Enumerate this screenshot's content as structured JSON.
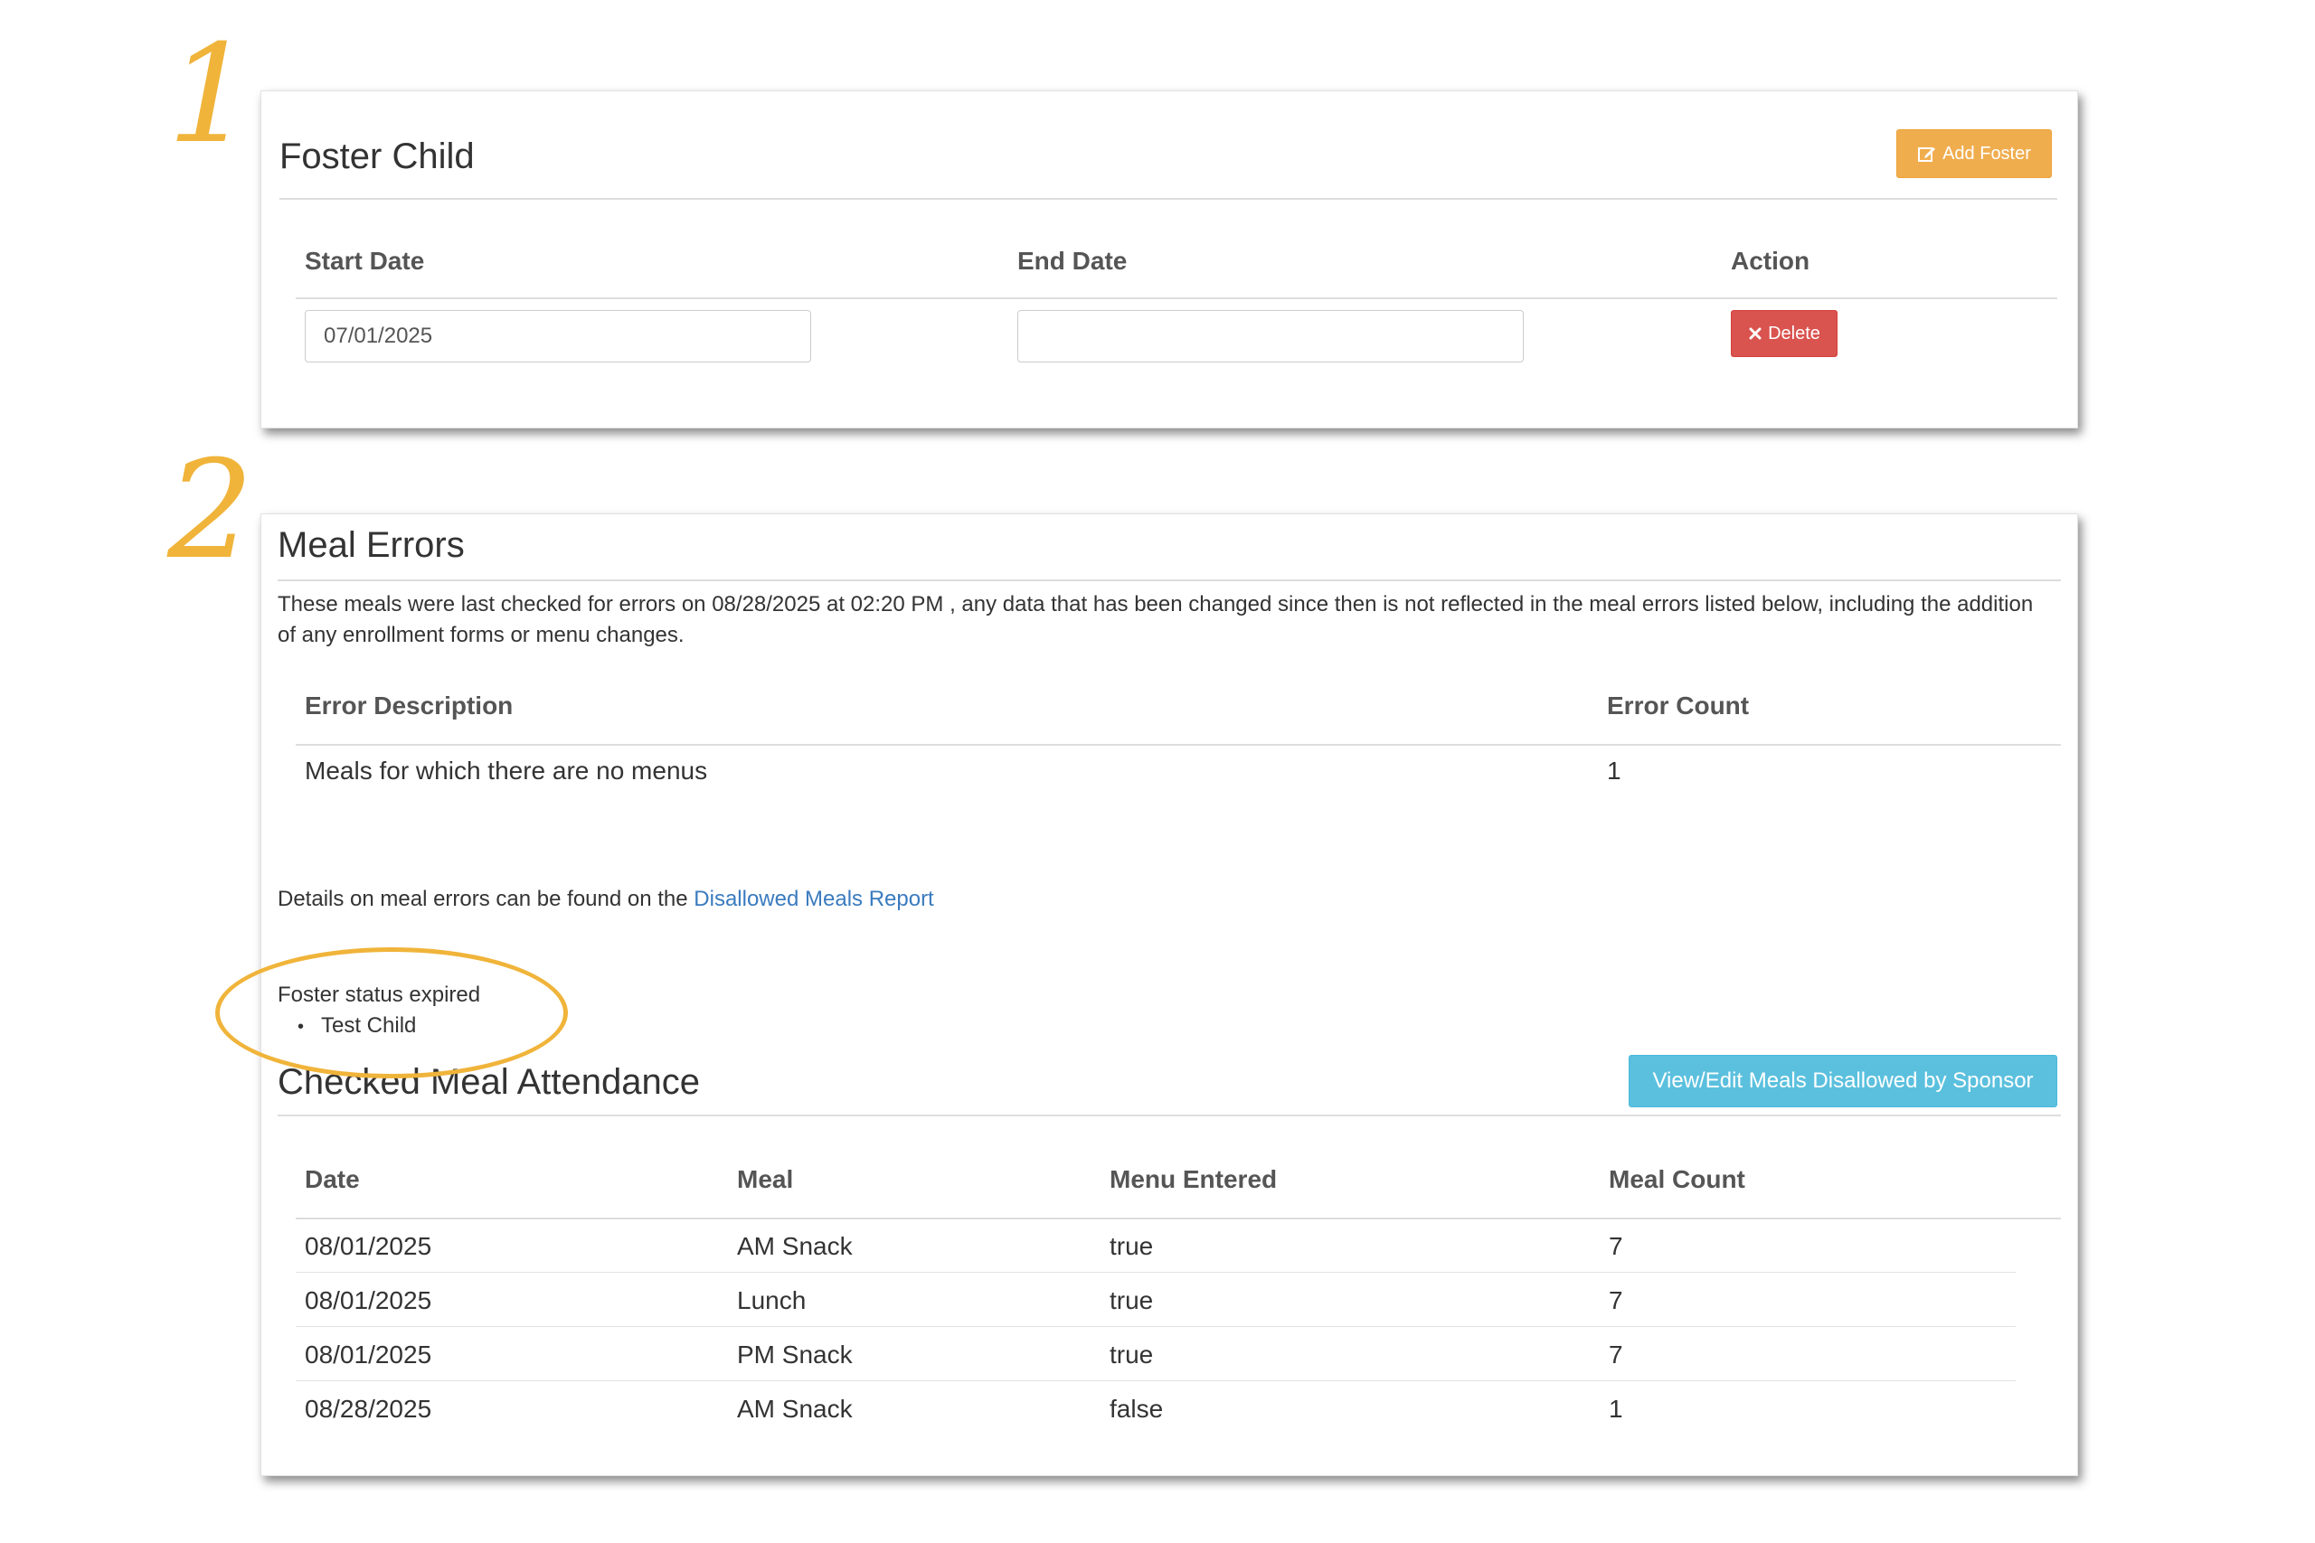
{
  "steps": {
    "one": "1",
    "two": "2"
  },
  "foster_child": {
    "title": "Foster Child",
    "add_button_label": "Add Foster",
    "columns": {
      "start_date": "Start Date",
      "end_date": "End Date",
      "action": "Action"
    },
    "row": {
      "start_date": "07/01/2025",
      "end_date": "",
      "delete_label": "Delete"
    }
  },
  "meal_errors": {
    "title": "Meal Errors",
    "notice_line1": "These meals were last checked for errors on 08/28/2025 at 02:20 PM , any data that has been changed since then is not reflected in the meal errors listed below, including the addition",
    "notice_line2": "of any enrollment forms or menu changes.",
    "columns": {
      "description": "Error Description",
      "count": "Error Count"
    },
    "rows": [
      {
        "description": "Meals for which there are no menus",
        "count": "1"
      }
    ],
    "details_prefix": "Details on meal errors can be found on the",
    "details_link": "Disallowed Meals Report",
    "foster_status_label": "Foster status expired",
    "foster_status_items": [
      "Test Child"
    ]
  },
  "checked_attendance": {
    "title": "Checked Meal Attendance",
    "view_edit_button": "View/Edit Meals Disallowed by Sponsor",
    "columns": {
      "date": "Date",
      "meal": "Meal",
      "menu_entered": "Menu Entered",
      "meal_count": "Meal Count"
    },
    "rows": [
      {
        "date": "08/01/2025",
        "meal": "AM Snack",
        "menu_entered": "true",
        "meal_count": "7"
      },
      {
        "date": "08/01/2025",
        "meal": "Lunch",
        "menu_entered": "true",
        "meal_count": "7"
      },
      {
        "date": "08/01/2025",
        "meal": "PM Snack",
        "menu_entered": "true",
        "meal_count": "7"
      },
      {
        "date": "08/28/2025",
        "meal": "AM Snack",
        "menu_entered": "false",
        "meal_count": "1"
      }
    ]
  },
  "colors": {
    "annotation": "#f0b43a",
    "warning": "#f0ad4e",
    "danger": "#d9534f",
    "info": "#5bc0de",
    "link": "#3a7bbf"
  }
}
